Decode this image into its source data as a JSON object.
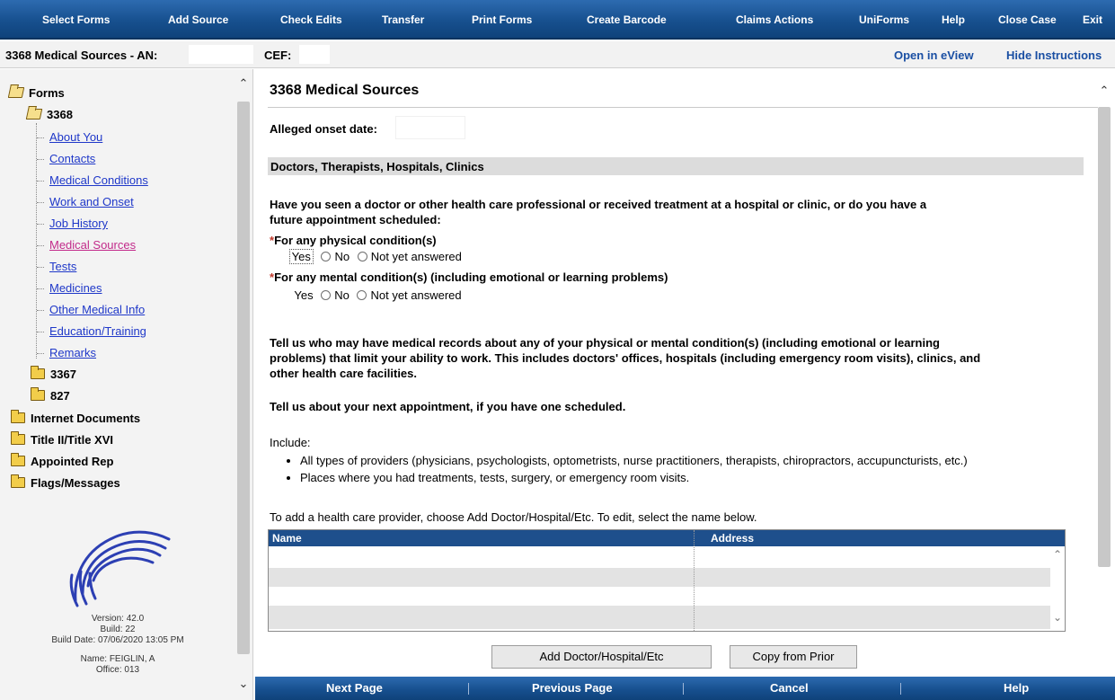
{
  "menu": {
    "select_forms": "Select Forms",
    "add_source": "Add Source",
    "check_edits": "Check Edits",
    "transfer": "Transfer",
    "print_forms": "Print Forms",
    "create_barcode": "Create Barcode",
    "claims_actions": "Claims Actions",
    "uniforms": "UniForms",
    "help": "Help",
    "close_case": "Close Case",
    "exit": "Exit"
  },
  "header": {
    "title": "3368 Medical Sources  - AN:",
    "cef_label": "CEF:",
    "open_in_eview": "Open in eView",
    "hide_instructions": "Hide Instructions"
  },
  "sidebar": {
    "root": "Forms",
    "form_3368": "3368",
    "items": [
      {
        "label": "About You",
        "active": false
      },
      {
        "label": "Contacts",
        "active": false
      },
      {
        "label": "Medical Conditions",
        "active": false
      },
      {
        "label": "Work and Onset",
        "active": false
      },
      {
        "label": "Job History",
        "active": false
      },
      {
        "label": "Medical Sources",
        "active": true
      },
      {
        "label": "Tests",
        "active": false
      },
      {
        "label": "Medicines",
        "active": false
      },
      {
        "label": "Other Medical Info",
        "active": false
      },
      {
        "label": "Education/Training",
        "active": false
      },
      {
        "label": "Remarks",
        "active": false
      }
    ],
    "form_3367": "3367",
    "form_827": "827",
    "top_folders": [
      "Internet Documents",
      "Title II/Title XVI",
      "Appointed Rep",
      "Flags/Messages"
    ],
    "version": "Version: 42.0",
    "build": "Build: 22",
    "build_date": "Build Date: 07/06/2020 13:05 PM",
    "name": "Name: FEIGLIN, A",
    "office": "Office: 013"
  },
  "main": {
    "title": "3368 Medical Sources",
    "onset_label": "Alleged onset date:",
    "section_header": "Doctors, Therapists, Hospitals, Clinics",
    "question_line1": "Have you seen a doctor or other health care professional or received treatment at a hospital or clinic, or do you have a",
    "question_line2": "future appointment scheduled:",
    "physical_label": "For any physical condition(s)",
    "mental_label": "For any mental condition(s) (including emotional or learning problems)",
    "opt_yes": "Yes",
    "opt_no": "No",
    "opt_not_yet": "Not yet answered",
    "records_line1": "Tell us who may have medical records about any of your physical or mental condition(s) (including emotional or learning",
    "records_line2": "problems) that limit your ability to work. This includes doctors' offices, hospitals (including emergency room visits), clinics, and",
    "records_line3": "other health care facilities.",
    "appointment": "Tell us about your next appointment, if you have one scheduled.",
    "include_label": "Include:",
    "bullets": [
      "All types of providers (physicians, psychologists, optometrists, nurse practitioners, therapists, chiropractors, accupuncturists, etc.)",
      "Places where you had treatments, tests, surgery, or emergency room visits."
    ],
    "add_instructions": "To add a health care provider, choose Add Doctor/Hospital/Etc. To edit, select the name below.",
    "table_headers": [
      "Name",
      "Address"
    ],
    "add_button": "Add Doctor/Hospital/Etc",
    "copy_button": "Copy from Prior"
  },
  "bottom": {
    "next": "Next Page",
    "previous": "Previous Page",
    "cancel": "Cancel",
    "help": "Help"
  }
}
